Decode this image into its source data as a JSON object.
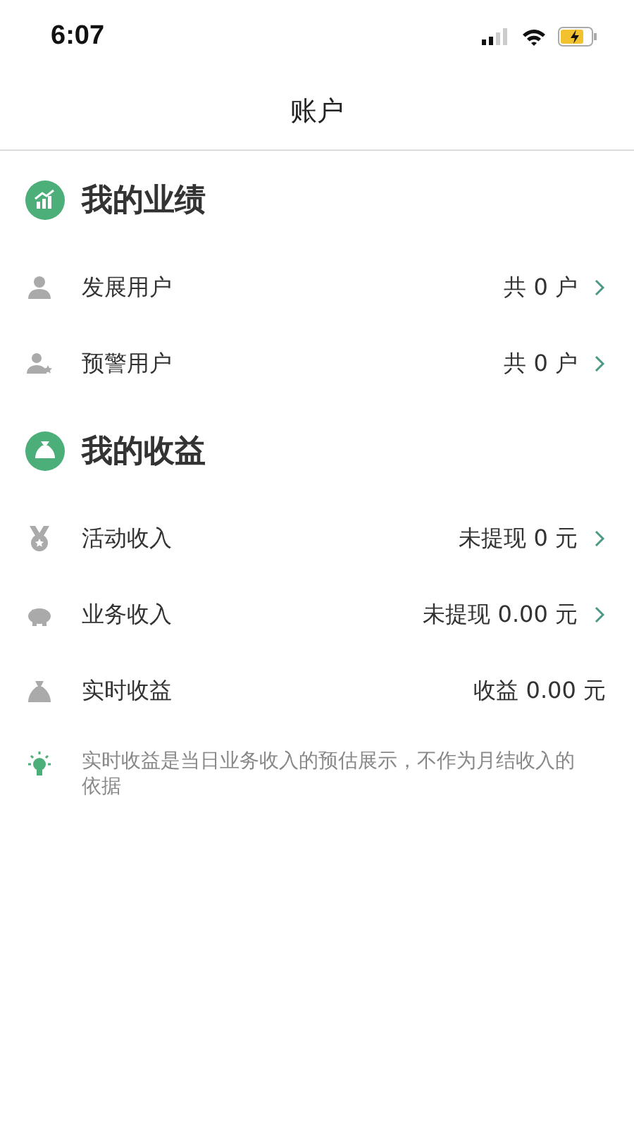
{
  "status_bar": {
    "time": "6:07"
  },
  "nav": {
    "title": "账户"
  },
  "sections": [
    {
      "title": "我的业绩",
      "kind": "chart",
      "rows": [
        {
          "kind": "person",
          "label": "发展用户",
          "value": "共 0 户",
          "chevron": true
        },
        {
          "kind": "person-star",
          "label": "预警用户",
          "value": "共 0 户",
          "chevron": true
        }
      ]
    },
    {
      "title": "我的收益",
      "kind": "money-bag",
      "rows": [
        {
          "kind": "medal",
          "label": "活动收入",
          "value": "未提现 0 元",
          "chevron": true
        },
        {
          "kind": "piggy",
          "label": "业务收入",
          "value": "未提现 0.00 元",
          "chevron": true
        },
        {
          "kind": "bag",
          "label": "实时收益",
          "value": "收益 0.00 元",
          "chevron": false
        }
      ]
    }
  ],
  "note": "实时收益是当日业务收入的预估展示，不作为月结收入的依据"
}
